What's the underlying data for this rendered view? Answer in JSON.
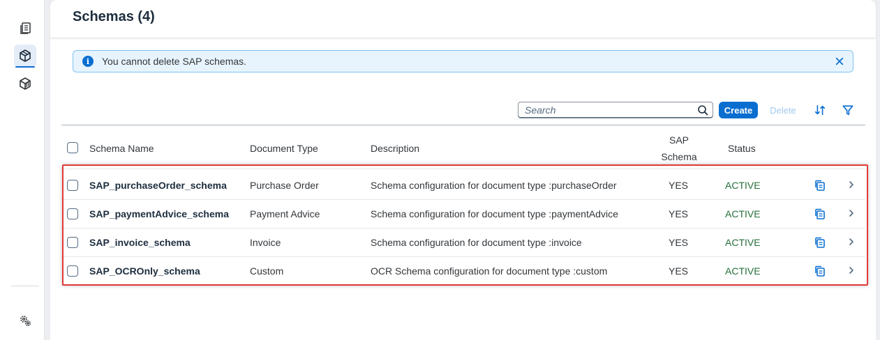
{
  "header": {
    "title": "Schemas (4)"
  },
  "message_strip": {
    "text": "You cannot delete SAP schemas."
  },
  "toolbar": {
    "search_placeholder": "Search",
    "create_label": "Create",
    "delete_label": "Delete"
  },
  "table": {
    "columns": {
      "name": "Schema Name",
      "doc_type": "Document Type",
      "description": "Description",
      "sap_line1": "SAP",
      "sap_line2": "Schema",
      "status": "Status"
    },
    "rows": [
      {
        "name": "SAP_purchaseOrder_schema",
        "doc_type": "Purchase Order",
        "description": "Schema configuration for document type :purchaseOrder",
        "sap": "YES",
        "status": "ACTIVE"
      },
      {
        "name": "SAP_paymentAdvice_schema",
        "doc_type": "Payment Advice",
        "description": "Schema configuration for document type :paymentAdvice",
        "sap": "YES",
        "status": "ACTIVE"
      },
      {
        "name": "SAP_invoice_schema",
        "doc_type": "Invoice",
        "description": "Schema configuration for document type :invoice",
        "sap": "YES",
        "status": "ACTIVE"
      },
      {
        "name": "SAP_OCROnly_schema",
        "doc_type": "Custom",
        "description": "OCR Schema configuration for document type :custom",
        "sap": "YES",
        "status": "ACTIVE"
      }
    ]
  },
  "colors": {
    "accent": "#0a6ed1",
    "status_active": "#256f3a",
    "highlight": "#e23a3a"
  }
}
